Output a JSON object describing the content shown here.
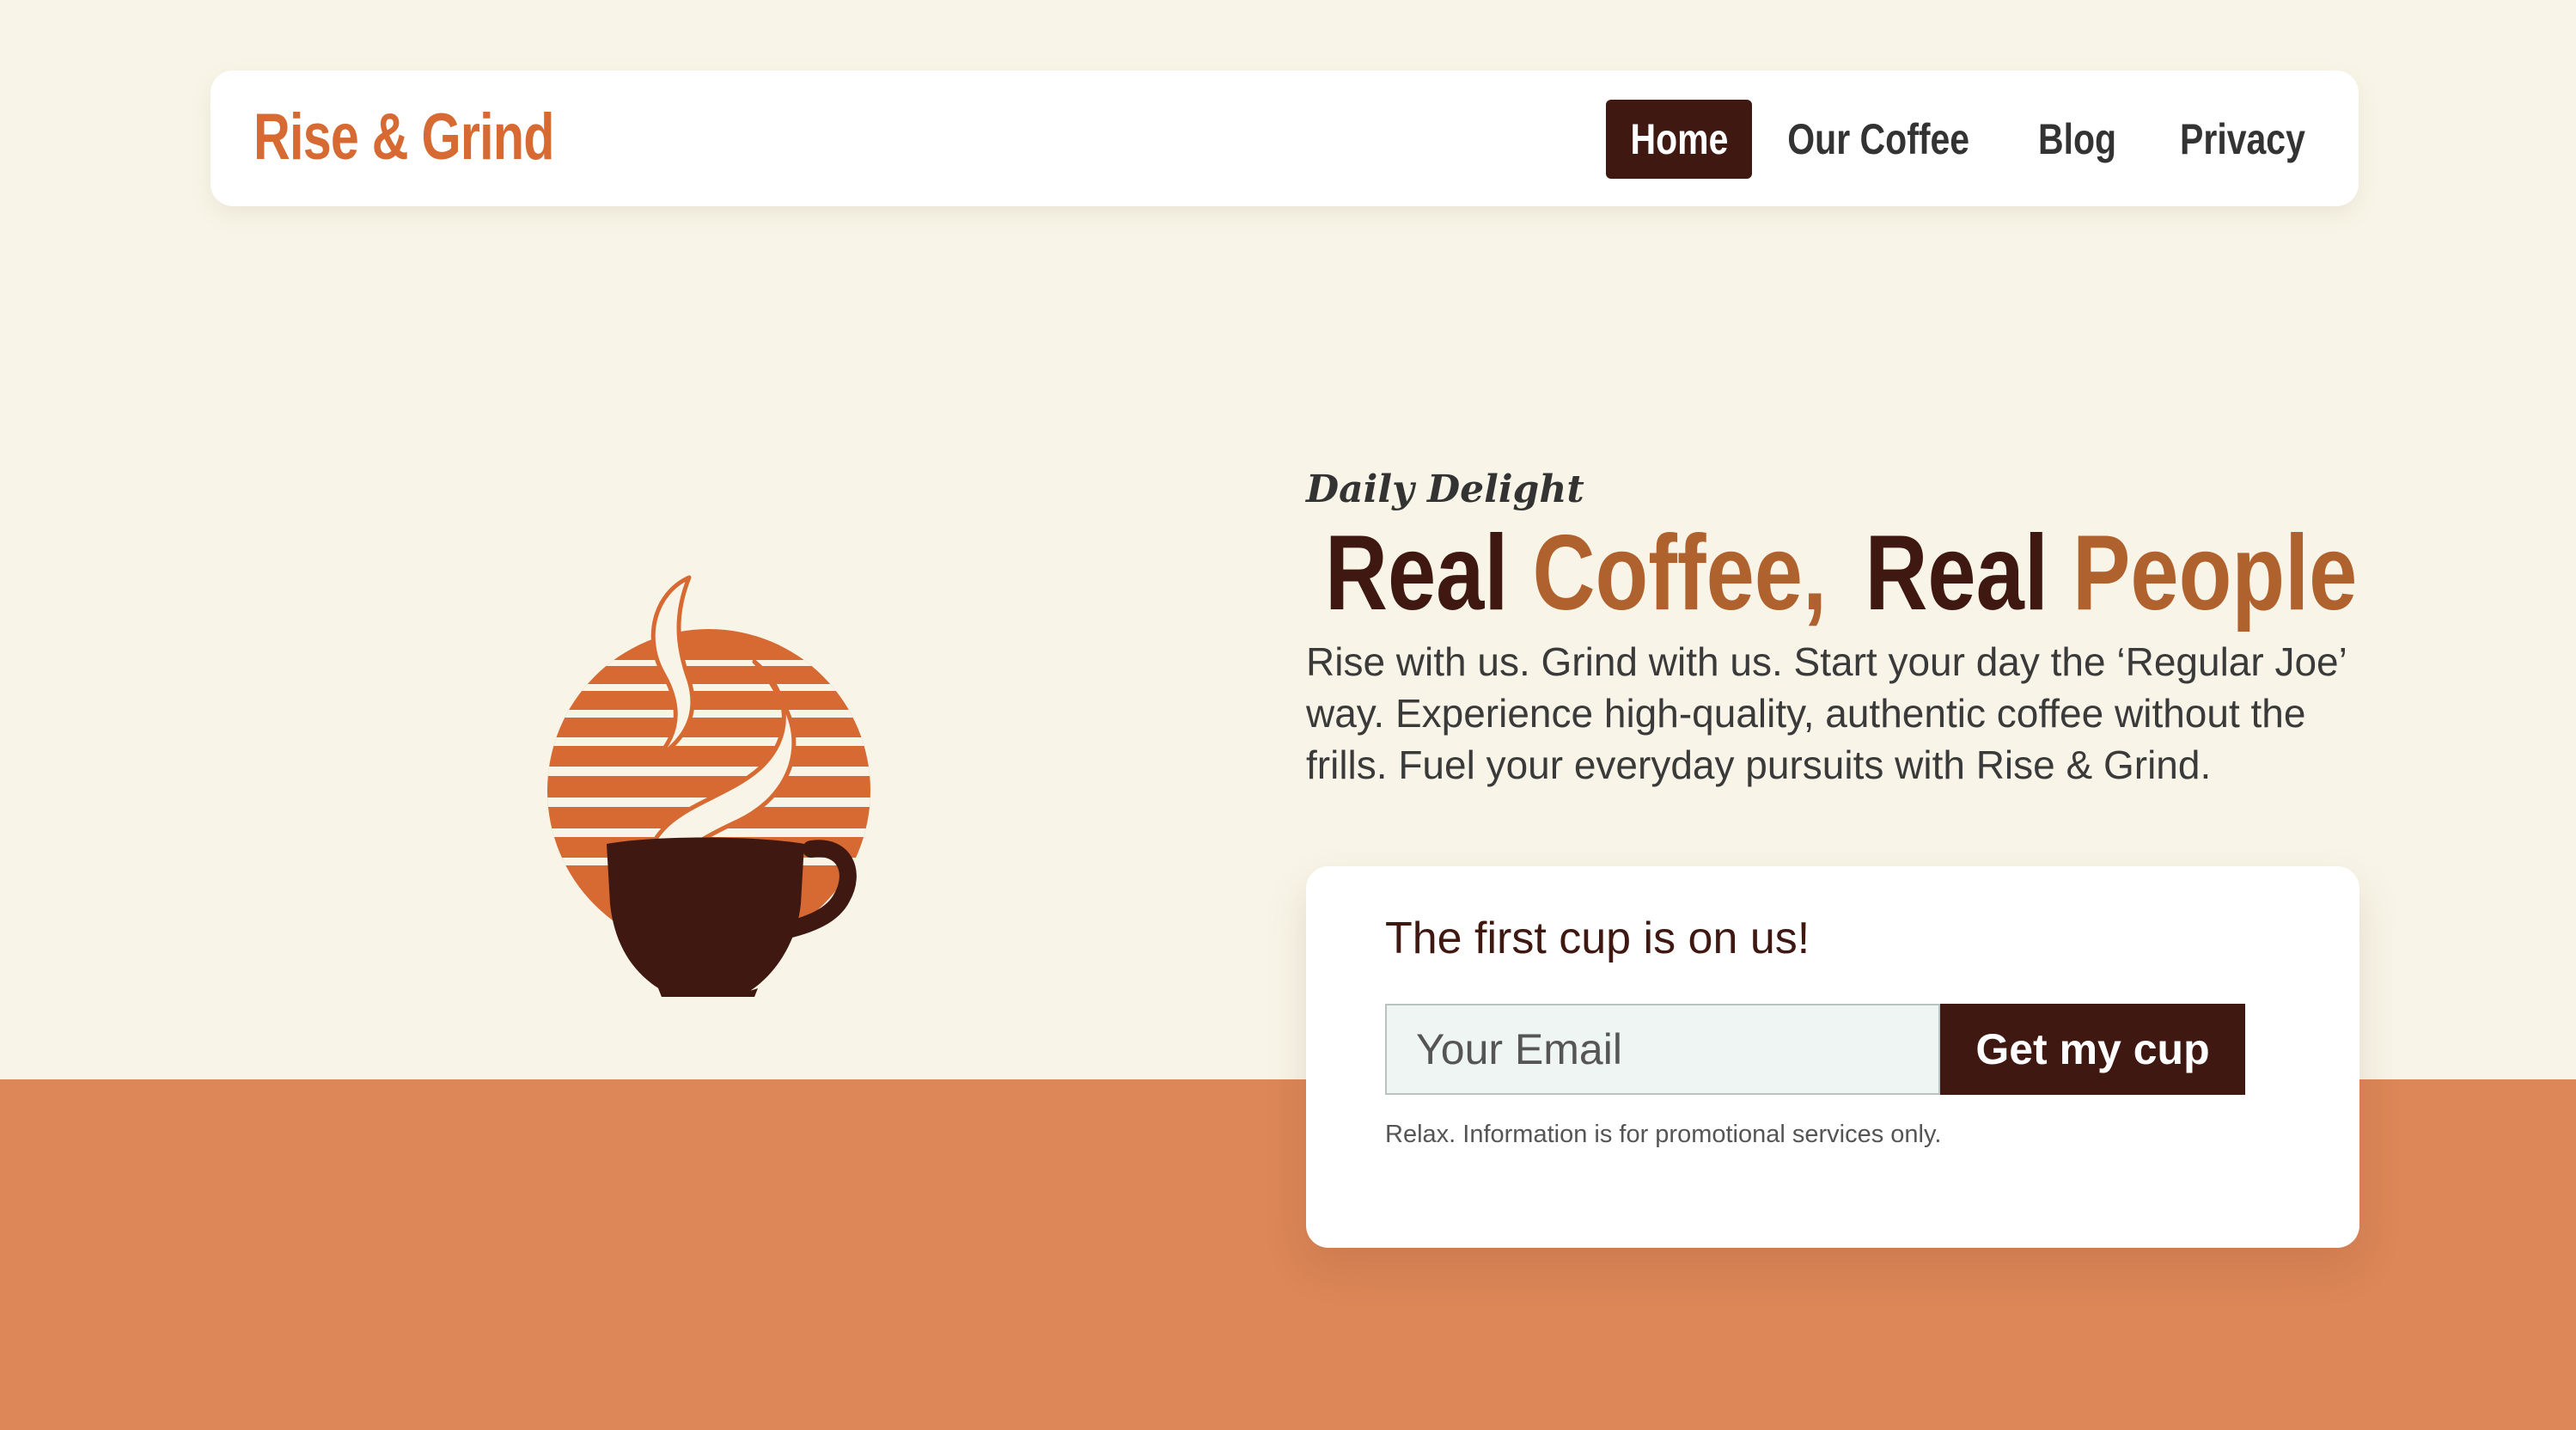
{
  "colors": {
    "page_background": "#f8f5e8",
    "bottom_band": "#dd8658",
    "brand": "#d66a32",
    "dark_brown": "#3f1812",
    "accent_brown": "#b0622e",
    "logo_orange": "#d66a32",
    "nav_text": "#333333"
  },
  "nav": {
    "brand": "Rise & Grind",
    "items": [
      {
        "label": "Home",
        "active": true
      },
      {
        "label": "Our Coffee",
        "active": false
      },
      {
        "label": "Blog",
        "active": false
      },
      {
        "label": "Privacy",
        "active": false
      }
    ]
  },
  "hero": {
    "logo_icon": "coffee-cup-sunrise-icon",
    "kicker": "Daily Delight",
    "headline": {
      "real_1": "Real",
      "coffee": "Coffee,",
      "real_2": "Real",
      "people": "People"
    },
    "description": "Rise with us. Grind with us. Start your day the ‘Regular Joe’ way. Experience high-quality, authentic coffee without the frills. Fuel your everyday pursuits with Rise & Grind."
  },
  "signup": {
    "title": "The first cup is on us!",
    "email_placeholder": "Your Email",
    "email_value": "",
    "button_label": "Get my cup",
    "note": "Relax. Information is for promotional services only."
  }
}
